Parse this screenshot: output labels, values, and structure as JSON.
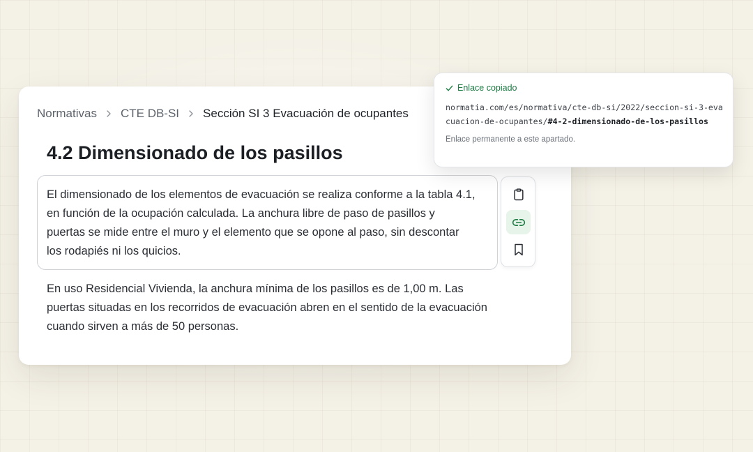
{
  "breadcrumb": {
    "items": [
      "Normativas",
      "CTE DB-SI"
    ],
    "current": "Sección SI 3 Evacuación de ocupantes"
  },
  "section": {
    "title": "4.2 Dimensionado de los pasillos",
    "selected_paragraph": "El dimensionado de los elementos de evacuación se realiza conforme a la tabla 4.1, en función de la ocupación calculada. La anchura libre de paso de pasillos y puertas se mide entre el muro y el elemento que se opone al paso, sin descontar los rodapiés ni los quicios.",
    "paragraph_2": "En uso Residencial Vivienda, la anchura mínima de los pasillos es de 1,00 m. Las puertas situadas en los recorridos de evacuación abren en el sentido de la evacuación cuando sirven a más de 50 personas."
  },
  "toolbar": {
    "tools": [
      {
        "icon": "clipboard-icon",
        "active": false
      },
      {
        "icon": "link-icon",
        "active": true
      },
      {
        "icon": "bookmark-icon",
        "active": false
      }
    ]
  },
  "popover": {
    "status": "Enlace copiado",
    "url_base": "normatia.com/es/normativa/cte-db-si/2022/seccion-si-3-evacuacion-de-ocupantes/",
    "url_anchor": "#4-2-dimensionado-de-los-pasillos",
    "note": "Enlace permanente a este apartado."
  },
  "colors": {
    "accent_green": "#1c7c43",
    "active_tool_bg": "#e6f4ea",
    "background": "#f4f1e7"
  }
}
